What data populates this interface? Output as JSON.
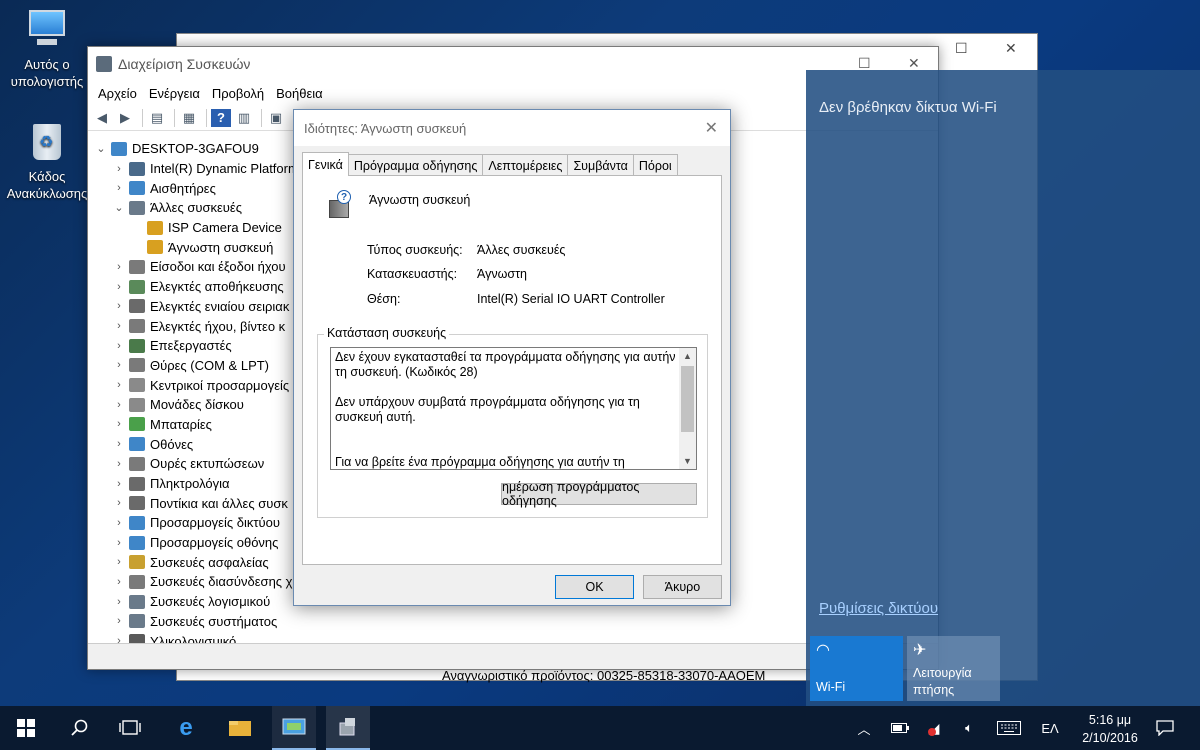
{
  "desktop": {
    "icons": [
      {
        "label": "Αυτός ο υπολογιστής",
        "icon": "this-pc-icon"
      },
      {
        "label": "Κάδος Ανακύκλωσης",
        "icon": "recycle-bin-icon"
      }
    ]
  },
  "bg_window": {
    "product_id": "Αναγνωριστικό προϊόντος: 00325-85318-33070-AAOEM"
  },
  "device_manager": {
    "title": "Διαχείριση Συσκευών",
    "menu": [
      "Αρχείο",
      "Ενέργεια",
      "Προβολή",
      "Βοήθεια"
    ],
    "root": "DESKTOP-3GAFOU9",
    "tree": [
      {
        "label": "Intel(R) Dynamic Platform",
        "level": 1,
        "expander": "›",
        "color": "#4a6a8a"
      },
      {
        "label": "Αισθητήρες",
        "level": 1,
        "expander": "›",
        "color": "#3f86c8"
      },
      {
        "label": "Άλλες συσκευές",
        "level": 1,
        "expander": "⌄",
        "color": "#6a7a8a"
      },
      {
        "label": "ISP Camera Device",
        "level": 2,
        "expander": "",
        "color": "#d8a020"
      },
      {
        "label": "Άγνωστη συσκευή",
        "level": 2,
        "expander": "",
        "color": "#d8a020"
      },
      {
        "label": "Είσοδοι και έξοδοι ήχου",
        "level": 1,
        "expander": "›",
        "color": "#7a7a7a"
      },
      {
        "label": "Ελεγκτές αποθήκευσης",
        "level": 1,
        "expander": "›",
        "color": "#5a8a5a"
      },
      {
        "label": "Ελεγκτές ενιαίου σειριακ",
        "level": 1,
        "expander": "›",
        "color": "#6a6a6a"
      },
      {
        "label": "Ελεγκτές ήχου, βίντεο κ",
        "level": 1,
        "expander": "›",
        "color": "#7a7a7a"
      },
      {
        "label": "Επεξεργαστές",
        "level": 1,
        "expander": "›",
        "color": "#4a7a4a"
      },
      {
        "label": "Θύρες (COM & LPT)",
        "level": 1,
        "expander": "›",
        "color": "#7a7a7a"
      },
      {
        "label": "Κεντρικοί προσαρμογείς",
        "level": 1,
        "expander": "›",
        "color": "#8a8a8a"
      },
      {
        "label": "Μονάδες δίσκου",
        "level": 1,
        "expander": "›",
        "color": "#8a8a8a"
      },
      {
        "label": "Μπαταρίες",
        "level": 1,
        "expander": "›",
        "color": "#4aa04a"
      },
      {
        "label": "Οθόνες",
        "level": 1,
        "expander": "›",
        "color": "#3f86c8"
      },
      {
        "label": "Ουρές εκτυπώσεων",
        "level": 1,
        "expander": "›",
        "color": "#7a7a7a"
      },
      {
        "label": "Πληκτρολόγια",
        "level": 1,
        "expander": "›",
        "color": "#6a6a6a"
      },
      {
        "label": "Ποντίκια και άλλες συσκ",
        "level": 1,
        "expander": "›",
        "color": "#6a6a6a"
      },
      {
        "label": "Προσαρμογείς δικτύου",
        "level": 1,
        "expander": "›",
        "color": "#3f86c8"
      },
      {
        "label": "Προσαρμογείς οθόνης",
        "level": 1,
        "expander": "›",
        "color": "#3f86c8"
      },
      {
        "label": "Συσκευές ασφαλείας",
        "level": 1,
        "expander": "›",
        "color": "#c8a030"
      },
      {
        "label": "Συσκευές διασύνδεσης χ",
        "level": 1,
        "expander": "›",
        "color": "#7a7a7a"
      },
      {
        "label": "Συσκευές λογισμικού",
        "level": 1,
        "expander": "›",
        "color": "#6a7a8a"
      },
      {
        "label": "Συσκευές συστήματος",
        "level": 1,
        "expander": "›",
        "color": "#6a7a8a"
      },
      {
        "label": "Υλικολογισμικό",
        "level": 1,
        "expander": "›",
        "color": "#5a5a5a"
      }
    ]
  },
  "dialog": {
    "title": "Ιδιότητες: Άγνωστη συσκευή",
    "tabs": [
      "Γενικά",
      "Πρόγραμμα οδήγησης",
      "Λεπτομέρειες",
      "Συμβάντα",
      "Πόροι"
    ],
    "device_name": "Άγνωστη συσκευή",
    "props": [
      {
        "label": "Τύπος συσκευής:",
        "value": "Άλλες συσκευές"
      },
      {
        "label": "Κατασκευαστής:",
        "value": "Άγνωστη"
      },
      {
        "label": "Θέση:",
        "value": "Intel(R) Serial IO UART Controller"
      }
    ],
    "status_legend": "Κατάσταση συσκευής",
    "status_text": "Δεν έχουν εγκατασταθεί τα προγράμματα οδήγησης για αυτήν τη συσκευή. (Κωδικός 28)\n\nΔεν υπάρχουν συμβατά προγράμματα οδήγησης για τη συσκευή αυτή.\n\n\nΓια να βρείτε ένα πρόγραμμα οδήγησης για αυτήν τη",
    "update_driver": "ημέρωση προγράμματος οδήγησης",
    "ok": "OK",
    "cancel": "Άκυρο"
  },
  "flyout": {
    "no_networks": "Δεν βρέθηκαν δίκτυα Wi-Fi",
    "network_settings": "Ρυθμίσεις δικτύου",
    "wifi_label": "Wi-Fi",
    "airplane_label": "Λειτουργία πτήσης"
  },
  "taskbar": {
    "language": "ΕΛ",
    "time": "5:16 μμ",
    "date": "2/10/2016"
  }
}
